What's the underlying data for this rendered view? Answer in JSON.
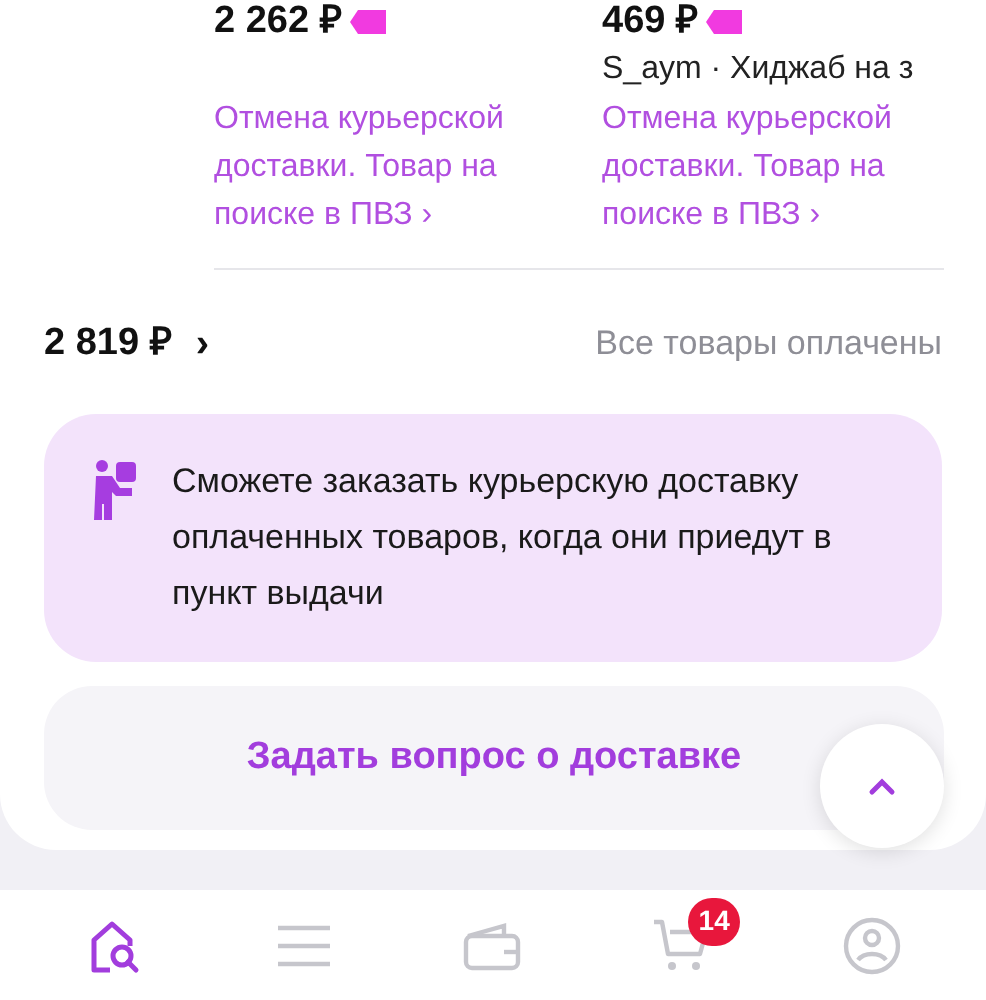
{
  "products": [
    {
      "price": "2 262 ₽",
      "status_link": "Отмена курьерской доставки. Товар на поиске в ПВЗ ›"
    },
    {
      "price": "469 ₽",
      "seller": "S_aym · Хиджаб на з",
      "status_link": "Отмена курьерской доставки. Товар на поиске в ПВЗ ›"
    }
  ],
  "total": {
    "amount": "2 819 ₽",
    "chevron": "›",
    "status": "Все товары оплачены"
  },
  "info": {
    "text": "Сможете заказать курьерскую доставку оплаченных товаров, когда они приедут в пункт выдачи"
  },
  "ask_button": "Задать вопрос о доставке",
  "bottom_nav": [
    {
      "kind": "home",
      "selected": true
    },
    {
      "kind": "catalog",
      "selected": false
    },
    {
      "kind": "wallet",
      "selected": false
    },
    {
      "kind": "cart",
      "selected": false,
      "badge": "14"
    },
    {
      "kind": "profile",
      "selected": false
    }
  ]
}
